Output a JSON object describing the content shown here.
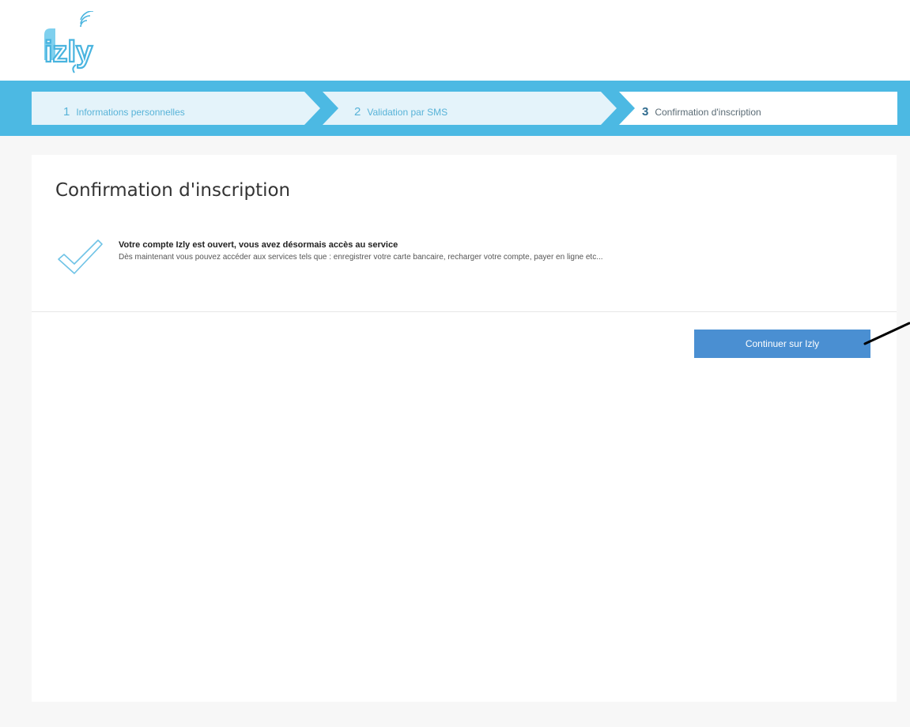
{
  "app": {
    "logo_text": "izly"
  },
  "steps": [
    {
      "number": "1",
      "label": "Informations personnelles"
    },
    {
      "number": "2",
      "label": "Validation par SMS"
    },
    {
      "number": "3",
      "label": "Confirmation d'inscription"
    }
  ],
  "active_step": 3,
  "main": {
    "title": "Confirmation d'inscription",
    "message_heading": "Votre compte Izly est ouvert, vous avez désormais accès au service",
    "message_body": "Dès maintenant vous pouvez accéder aux services tels que : enregistrer votre carte bancaire, recharger votre compte, payer en ligne etc...",
    "continue_label": "Continuer sur Izly"
  },
  "colors": {
    "accent": "#4cb9e3",
    "button": "#4a8fd2",
    "step_inactive_bg": "#e4f3fa",
    "step_active_bg": "#ffffff"
  },
  "icons": {
    "logo": "izly-logo",
    "success": "check-icon"
  }
}
